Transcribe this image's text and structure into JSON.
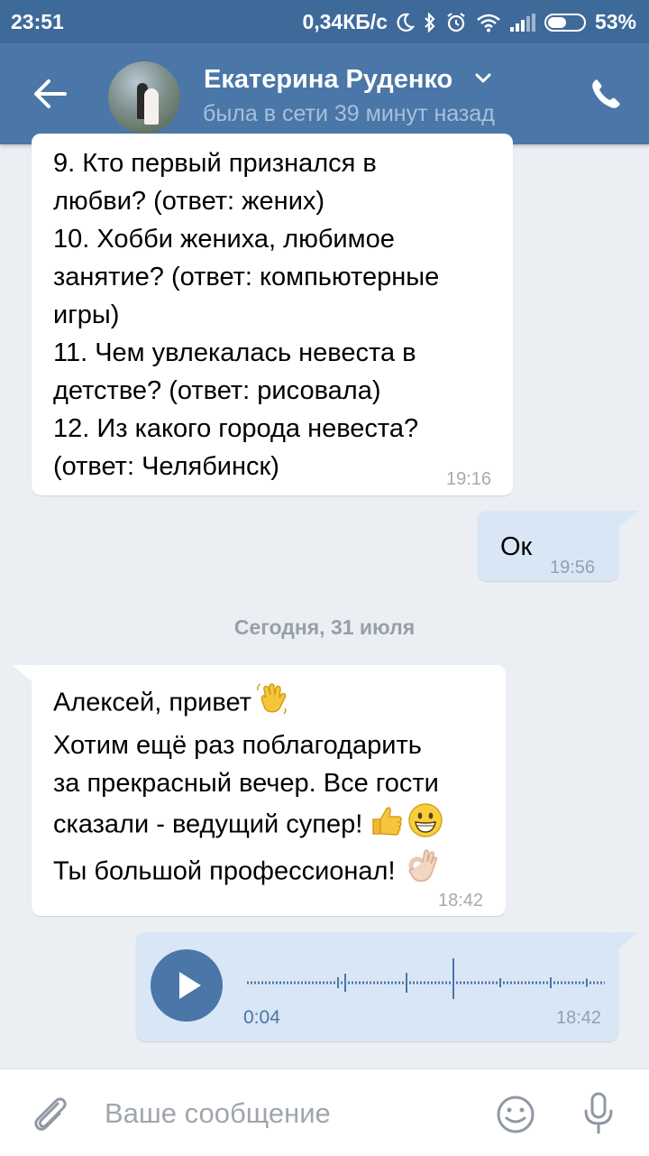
{
  "status_bar": {
    "time": "23:51",
    "net_speed": "0,34КБ/с",
    "battery": "53%",
    "battery_level": 0.53
  },
  "header": {
    "contact_name": "Екатерина Руденко",
    "contact_status": "была в сети 39 минут назад",
    "colors": {
      "bar": "#4a76a8",
      "status_bar": "#3e6a9a"
    }
  },
  "messages": {
    "m1": {
      "lines": [
        " 9. Кто первый признался в",
        "любви? (ответ: жених)",
        " 10. Хобби жениха, любимое",
        "занятие? (ответ: компьютерные",
        "игры)",
        " 11. Чем увлекалась невеста в",
        "детстве? (ответ: рисовала)",
        " 12. Из какого города невеста?",
        "(ответ: Челябинск)"
      ],
      "time": "19:16"
    },
    "m2": {
      "text": "Ок",
      "time": "19:56"
    },
    "date_separator": "Сегодня, 31 июля",
    "m3": {
      "lines": [
        "Алексей, привет",
        "Хотим ещё раз поблагодарить",
        "за прекрасный вечер. Все гости",
        "сказали - ведущий супер!",
        "Ты  большой профессионал!"
      ],
      "emoji": [
        "waving-hand",
        "thumbs-up",
        "grinning-face",
        "ok-hand"
      ],
      "time": "18:42"
    },
    "m4": {
      "duration": "0:04",
      "time": "18:42"
    }
  },
  "input": {
    "placeholder": "Ваше сообщение"
  }
}
